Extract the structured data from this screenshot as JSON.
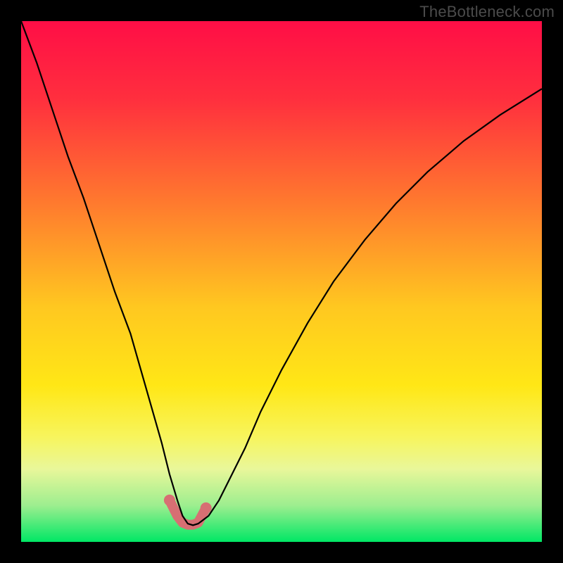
{
  "watermark": "TheBottleneck.com",
  "chart_data": {
    "type": "line",
    "title": "",
    "xlabel": "",
    "ylabel": "",
    "xlim": [
      0,
      100
    ],
    "ylim": [
      0,
      100
    ],
    "gradient_stops": [
      {
        "offset": 0,
        "color": "#ff0e46"
      },
      {
        "offset": 15,
        "color": "#ff2f3e"
      },
      {
        "offset": 35,
        "color": "#ff7a2e"
      },
      {
        "offset": 55,
        "color": "#ffc820"
      },
      {
        "offset": 70,
        "color": "#ffe716"
      },
      {
        "offset": 80,
        "color": "#f7f55e"
      },
      {
        "offset": 86,
        "color": "#e9f79a"
      },
      {
        "offset": 93,
        "color": "#9dee8f"
      },
      {
        "offset": 100,
        "color": "#00e765"
      }
    ],
    "series": [
      {
        "name": "bottleneck-curve",
        "color": "#000000",
        "x": [
          0,
          3,
          6,
          9,
          12,
          15,
          18,
          21,
          23,
          25,
          27,
          28.5,
          30,
          31,
          32,
          33,
          34,
          36,
          38,
          40,
          43,
          46,
          50,
          55,
          60,
          66,
          72,
          78,
          85,
          92,
          100
        ],
        "y": [
          100,
          92,
          83,
          74,
          66,
          57,
          48,
          40,
          33,
          26,
          19,
          13,
          8,
          5,
          3.5,
          3.2,
          3.5,
          5,
          8,
          12,
          18,
          25,
          33,
          42,
          50,
          58,
          65,
          71,
          77,
          82,
          87
        ]
      },
      {
        "name": "valley-highlight",
        "color": "#d76f73",
        "thickness": 14,
        "x": [
          28.5,
          30,
          31,
          32,
          33,
          34,
          35.5
        ],
        "y": [
          8,
          5,
          3.7,
          3.3,
          3.3,
          3.7,
          6.5
        ]
      }
    ]
  }
}
